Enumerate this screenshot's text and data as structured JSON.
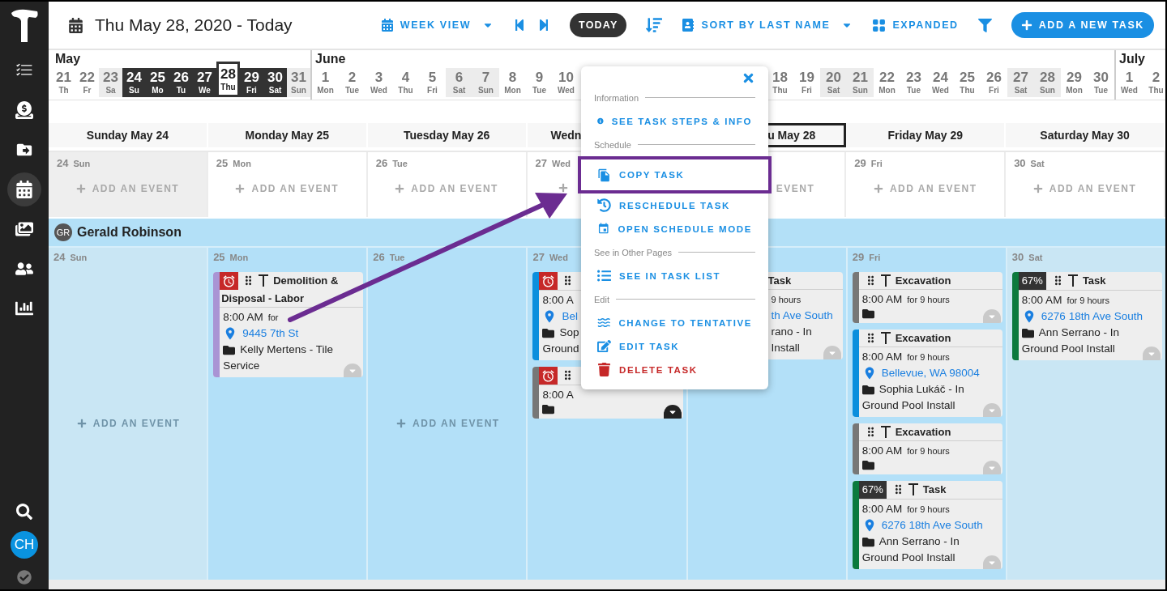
{
  "sidebar": {
    "items": [
      {
        "kind": "tasks",
        "selected": false
      },
      {
        "kind": "billing",
        "selected": false
      },
      {
        "kind": "files",
        "selected": false
      },
      {
        "kind": "calendar",
        "selected": true
      },
      {
        "kind": "photos",
        "selected": false
      },
      {
        "kind": "people",
        "selected": false
      },
      {
        "kind": "reports",
        "selected": false
      }
    ],
    "user_initials": "CH"
  },
  "toolbar": {
    "title": "Thu May 28, 2020 - Today",
    "view": "WEEK VIEW",
    "today": "TODAY",
    "sort": "SORT BY LAST NAME",
    "layout": "EXPANDED",
    "add": "ADD A NEW TASK"
  },
  "date_strip": [
    {
      "month": "May",
      "days": [
        {
          "n": "21",
          "d": "Th",
          "weekend": false,
          "selected": false,
          "today": false
        },
        {
          "n": "22",
          "d": "Fr",
          "weekend": false,
          "selected": false,
          "today": false
        },
        {
          "n": "23",
          "d": "Sa",
          "weekend": true,
          "selected": false,
          "today": false
        },
        {
          "n": "24",
          "d": "Su",
          "weekend": false,
          "selected": true,
          "today": false
        },
        {
          "n": "25",
          "d": "Mo",
          "weekend": false,
          "selected": true,
          "today": false
        },
        {
          "n": "26",
          "d": "Tu",
          "weekend": false,
          "selected": true,
          "today": false
        },
        {
          "n": "27",
          "d": "We",
          "weekend": false,
          "selected": true,
          "today": false
        },
        {
          "n": "28",
          "d": "Thu",
          "weekend": false,
          "selected": true,
          "today": true
        },
        {
          "n": "29",
          "d": "Fri",
          "weekend": false,
          "selected": true,
          "today": false
        },
        {
          "n": "30",
          "d": "Sat",
          "weekend": false,
          "selected": true,
          "today": false
        },
        {
          "n": "31",
          "d": "Sun",
          "weekend": true,
          "selected": false,
          "today": false
        }
      ]
    },
    {
      "month": "June",
      "days": [
        {
          "n": "1",
          "d": "Mon",
          "weekend": false,
          "selected": false,
          "today": false
        },
        {
          "n": "2",
          "d": "Tue",
          "weekend": false,
          "selected": false,
          "today": false
        },
        {
          "n": "3",
          "d": "Wed",
          "weekend": false,
          "selected": false,
          "today": false
        },
        {
          "n": "4",
          "d": "Thu",
          "weekend": false,
          "selected": false,
          "today": false
        },
        {
          "n": "5",
          "d": "Fri",
          "weekend": false,
          "selected": false,
          "today": false
        },
        {
          "n": "6",
          "d": "Sat",
          "weekend": true,
          "selected": false,
          "today": false
        },
        {
          "n": "7",
          "d": "Sun",
          "weekend": true,
          "selected": false,
          "today": false
        },
        {
          "n": "8",
          "d": "Mon",
          "weekend": false,
          "selected": false,
          "today": false
        },
        {
          "n": "9",
          "d": "Tue",
          "weekend": false,
          "selected": false,
          "today": false
        },
        {
          "n": "10",
          "d": "Wed",
          "weekend": false,
          "selected": false,
          "today": false
        },
        {
          "n": "18",
          "d": "Thu",
          "weekend": false,
          "selected": false,
          "today": false,
          "gap_before": true
        },
        {
          "n": "19",
          "d": "Fri",
          "weekend": false,
          "selected": false,
          "today": false
        },
        {
          "n": "20",
          "d": "Sat",
          "weekend": true,
          "selected": false,
          "today": false
        },
        {
          "n": "21",
          "d": "Sun",
          "weekend": true,
          "selected": false,
          "today": false
        },
        {
          "n": "22",
          "d": "Mon",
          "weekend": false,
          "selected": false,
          "today": false
        },
        {
          "n": "23",
          "d": "Tue",
          "weekend": false,
          "selected": false,
          "today": false
        },
        {
          "n": "24",
          "d": "Wed",
          "weekend": false,
          "selected": false,
          "today": false
        },
        {
          "n": "25",
          "d": "Thu",
          "weekend": false,
          "selected": false,
          "today": false
        },
        {
          "n": "26",
          "d": "Fri",
          "weekend": false,
          "selected": false,
          "today": false
        },
        {
          "n": "27",
          "d": "Sat",
          "weekend": true,
          "selected": false,
          "today": false
        },
        {
          "n": "28",
          "d": "Sun",
          "weekend": true,
          "selected": false,
          "today": false
        },
        {
          "n": "29",
          "d": "Mon",
          "weekend": false,
          "selected": false,
          "today": false
        },
        {
          "n": "30",
          "d": "Tue",
          "weekend": false,
          "selected": false,
          "today": false
        }
      ]
    },
    {
      "month": "July",
      "days": [
        {
          "n": "1",
          "d": "Wed",
          "weekend": false,
          "selected": false,
          "today": false
        },
        {
          "n": "2",
          "d": "Thu",
          "weekend": false,
          "selected": false,
          "today": false
        }
      ]
    }
  ],
  "week_headers": [
    {
      "kind": "full",
      "label": "Sunday May 24",
      "today": false
    },
    {
      "kind": "full",
      "label": "Monday May 25",
      "today": false
    },
    {
      "kind": "full",
      "label": "Tuesday May 26",
      "today": false
    },
    {
      "kind": "head",
      "label": "Wedn",
      "today": false
    },
    {
      "kind": "tail",
      "label": "u May 28",
      "today": true
    },
    {
      "kind": "full",
      "label": "Friday May 29",
      "today": false
    },
    {
      "kind": "full",
      "label": "Saturday May 30",
      "today": false
    }
  ],
  "event_row": [
    {
      "kind": "full",
      "date": "24",
      "day": "Sun",
      "weekend": true,
      "add": "ADD AN EVENT"
    },
    {
      "kind": "full",
      "date": "25",
      "day": "Mon",
      "weekend": false,
      "add": "ADD AN EVENT"
    },
    {
      "kind": "full",
      "date": "26",
      "day": "Tue",
      "weekend": false,
      "add": "ADD AN EVENT"
    },
    {
      "kind": "head",
      "date": "27",
      "day": "Wed",
      "weekend": false
    },
    {
      "kind": "tail",
      "weekend": false,
      "add": "EVENT"
    },
    {
      "kind": "full",
      "date": "29",
      "day": "Fri",
      "weekend": false,
      "add": "ADD AN EVENT"
    },
    {
      "kind": "full",
      "date": "30",
      "day": "Sat",
      "weekend": false,
      "add": "ADD AN EVENT"
    }
  ],
  "person": {
    "initials": "GR",
    "name": "Gerald Robinson"
  },
  "task_columns": [
    {
      "date": "24",
      "day": "Sun",
      "weekend": true,
      "add": "ADD AN EVENT"
    },
    {
      "date": "25",
      "day": "Mon",
      "weekend": false,
      "cards": [
        {
          "kind": "card",
          "color": "#a994d4",
          "alarm": true,
          "grip": true,
          "tool": true,
          "title": [
            "Demolition &",
            "Disposal - Labor"
          ],
          "time": "8:00 AM",
          "duration": "for",
          "address": "9445 7th St",
          "folder": true,
          "project": [
            "Kelly Mertens - Tile",
            "Service"
          ],
          "expander": true,
          "active": false
        }
      ]
    },
    {
      "date": "26",
      "day": "Tue",
      "weekend": false,
      "add": "ADD AN EVENT"
    },
    {
      "date": "27",
      "day": "Wed",
      "weekend": false,
      "cards": [
        {
          "kind": "head",
          "color": "#0b8fdd",
          "alarm": true,
          "grip": true,
          "tool": false,
          "time": "8:00 A",
          "address": "Bel",
          "folder": true,
          "project": [
            "Sop",
            "Ground"
          ]
        },
        {
          "kind": "head",
          "color": "#777777",
          "alarm": true,
          "grip": true,
          "tool": false,
          "time": "8:00 A",
          "folder": true,
          "expander": true,
          "active": true
        }
      ]
    },
    {
      "weekend": false,
      "cards": [
        {
          "kind": "tail",
          "title": [
            "Task"
          ],
          "duration": "9 hours",
          "address": "th Ave South",
          "project": [
            "rano - In",
            "Install"
          ],
          "expander": true,
          "active": false
        }
      ]
    },
    {
      "date": "29",
      "day": "Fri",
      "weekend": false,
      "cards": [
        {
          "kind": "card",
          "color": "#777777",
          "alarm": false,
          "grip": true,
          "tool": true,
          "title": [
            "Excavation"
          ],
          "time": "8:00 AM",
          "duration": "for 9 hours",
          "folder": true,
          "expander": true,
          "active": false
        },
        {
          "kind": "card",
          "color": "#0b8fdd",
          "alarm": false,
          "grip": true,
          "tool": true,
          "title": [
            "Excavation"
          ],
          "time": "8:00 AM",
          "duration": "for 9 hours",
          "address": "Bellevue, WA 98004",
          "folder": true,
          "project": [
            "Sophia Lukáč - In",
            "Ground Pool Install"
          ],
          "expander": true,
          "active": false
        },
        {
          "kind": "card",
          "color": "#777777",
          "alarm": false,
          "grip": true,
          "tool": true,
          "title": [
            "Excavation"
          ],
          "time": "8:00 AM",
          "duration": "for 9 hours",
          "folder": true,
          "expander": true,
          "active": false
        },
        {
          "kind": "card",
          "color": "#0b7a3e",
          "alarm": false,
          "percent": "67%",
          "grip": true,
          "tool": true,
          "title": [
            "Task"
          ],
          "time": "8:00 AM",
          "duration": "for 9 hours",
          "address": "6276 18th Ave South",
          "folder": true,
          "project": [
            "Ann Serrano - In",
            "Ground Pool Install"
          ],
          "expander": true,
          "active": false
        }
      ]
    },
    {
      "date": "30",
      "day": "Sat",
      "weekend": true,
      "cards": [
        {
          "kind": "card",
          "color": "#0b7a3e",
          "alarm": false,
          "percent": "67%",
          "grip": true,
          "tool": true,
          "title": [
            "Task"
          ],
          "time": "8:00 AM",
          "duration": "for 9 hours",
          "address": "6276 18th Ave South",
          "folder": true,
          "project": [
            "Ann Serrano - In",
            "Ground Pool Install"
          ],
          "expander": true,
          "active": false
        }
      ]
    }
  ],
  "context_menu": {
    "rows": [
      {
        "kind": "section",
        "label": "Information"
      },
      {
        "kind": "info",
        "label": "SEE TASK STEPS & INFO",
        "danger": false,
        "highlighted": false
      },
      {
        "kind": "section",
        "label": "Schedule"
      },
      {
        "kind": "copy",
        "label": "COPY TASK",
        "danger": false,
        "highlighted": true
      },
      {
        "kind": "history",
        "label": "RESCHEDULE TASK",
        "danger": false,
        "highlighted": false
      },
      {
        "kind": "calendar",
        "label": "OPEN SCHEDULE MODE",
        "danger": false,
        "highlighted": false
      },
      {
        "kind": "section",
        "label": "See in Other Pages"
      },
      {
        "kind": "list",
        "label": "SEE IN TASK LIST",
        "danger": false,
        "highlighted": false
      },
      {
        "kind": "section",
        "label": "Edit"
      },
      {
        "kind": "waves",
        "label": "CHANGE TO TENTATIVE",
        "danger": false,
        "highlighted": false
      },
      {
        "kind": "edit",
        "label": "EDIT TASK",
        "danger": false,
        "highlighted": false
      },
      {
        "kind": "trash",
        "label": "DELETE TASK",
        "danger": true,
        "highlighted": false
      }
    ]
  },
  "annotation": {
    "color": "#6b2c91"
  }
}
